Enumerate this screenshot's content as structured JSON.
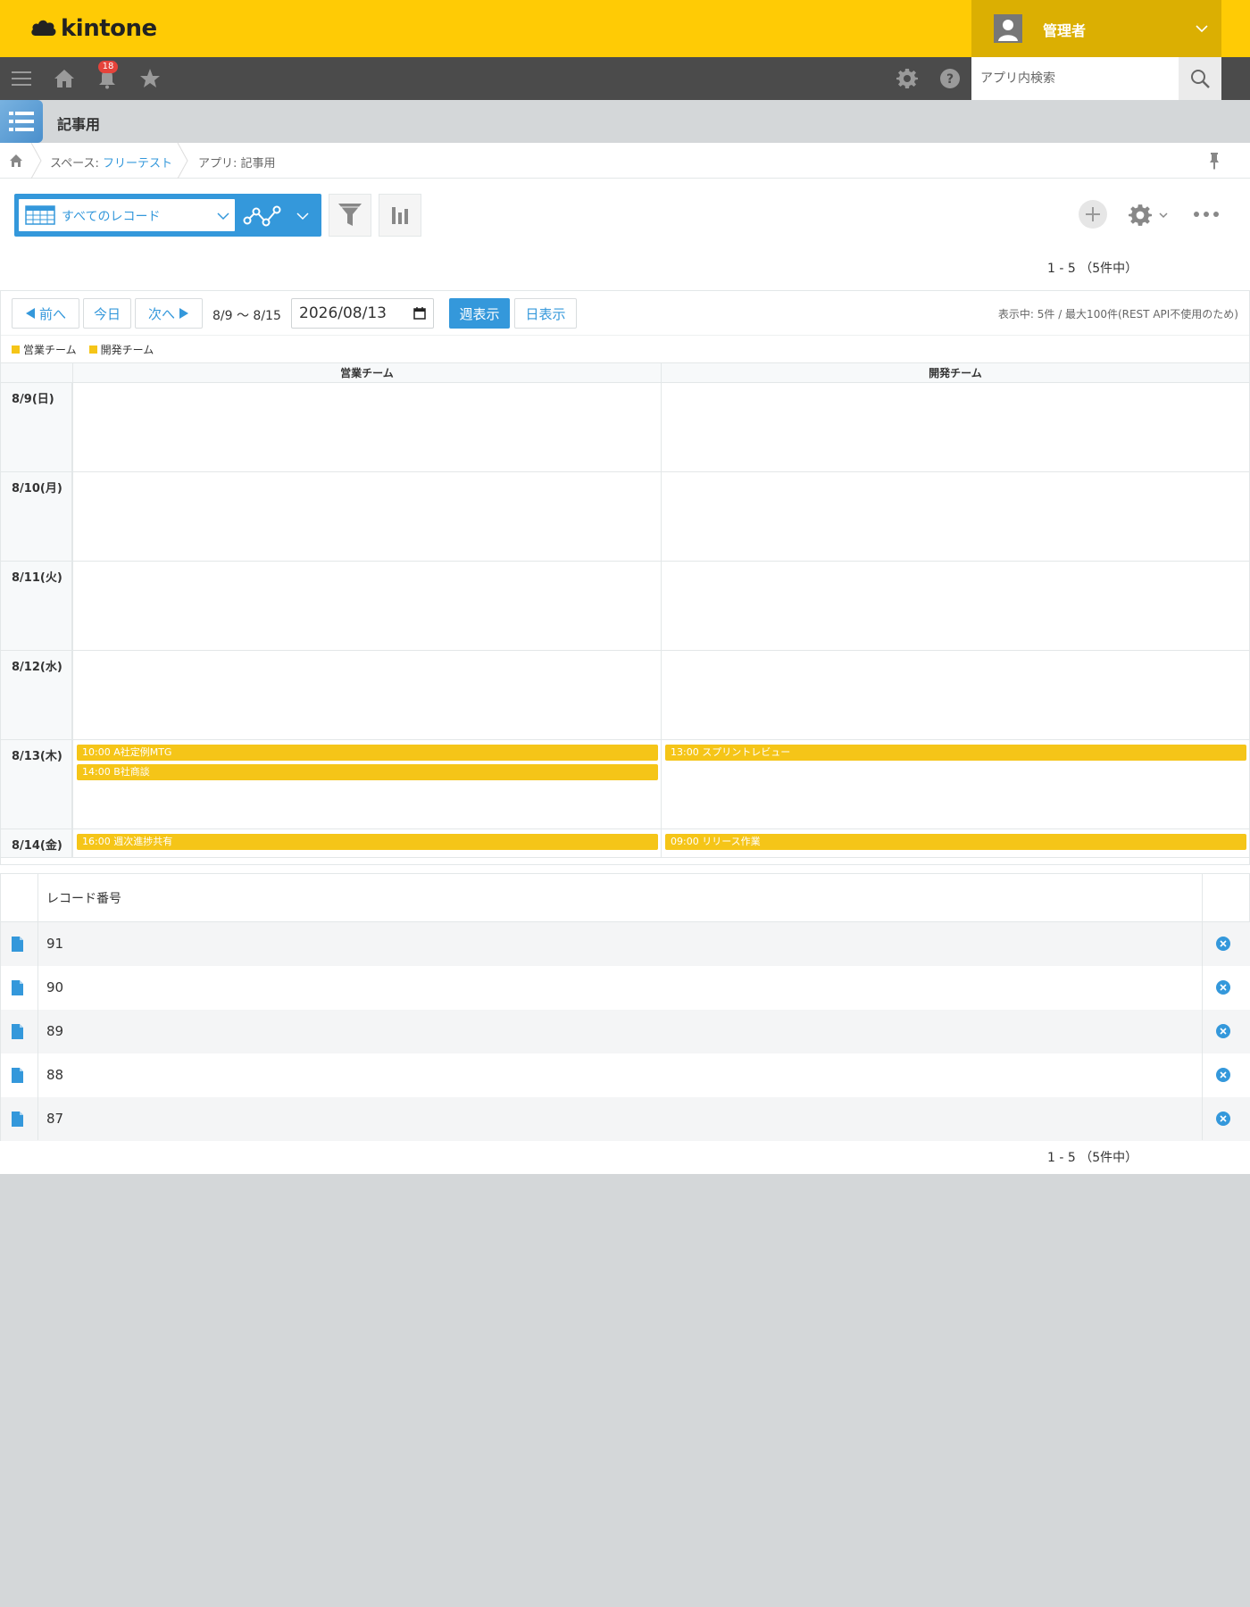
{
  "header": {
    "logo_text": "kintone",
    "user_name": "管理者",
    "notification_count": "18",
    "search_placeholder": "アプリ内検索"
  },
  "app": {
    "title": "記事用"
  },
  "breadcrumb": {
    "space_prefix": "スペース: ",
    "space_name": "フリーテスト",
    "app_label": "アプリ: 記事用"
  },
  "toolbar": {
    "view_name": "すべてのレコード"
  },
  "pager": {
    "top": "1 - 5 （5件中）",
    "bottom": "1 - 5 （5件中）"
  },
  "calendar": {
    "prev_label": "前へ",
    "today_label": "今日",
    "next_label": "次へ",
    "range_label": "8/9 〜 8/15",
    "date_value": "2026/08/13",
    "week_view_label": "週表示",
    "day_view_label": "日表示",
    "info_text": "表示中: 5件 / 最大100件(REST API不使用のため)",
    "event_color": "#f5c518",
    "legend": [
      {
        "label": "営業チーム"
      },
      {
        "label": "開発チーム"
      }
    ],
    "columns": [
      "営業チーム",
      "開発チーム"
    ],
    "days": [
      {
        "label": "8/9(日)",
        "team1_events": [],
        "team2_events": []
      },
      {
        "label": "8/10(月)",
        "team1_events": [],
        "team2_events": []
      },
      {
        "label": "8/11(火)",
        "team1_events": [],
        "team2_events": []
      },
      {
        "label": "8/12(水)",
        "team1_events": [],
        "team2_events": []
      },
      {
        "label": "8/13(木)",
        "team1_events": [
          "10:00 A社定例MTG",
          "14:00 B社商談"
        ],
        "team2_events": [
          "13:00 スプリントレビュー"
        ]
      },
      {
        "label": "8/14(金)",
        "team1_events": [
          "16:00 週次進捗共有"
        ],
        "team2_events": [
          "09:00 リリース作業"
        ]
      }
    ]
  },
  "records": {
    "header_label": "レコード番号",
    "rows": [
      "91",
      "90",
      "89",
      "88",
      "87"
    ]
  },
  "colors": {
    "brand_yellow": "#ffcb05",
    "accent_blue": "#3498db",
    "nav_dark": "#4b4b4b"
  }
}
